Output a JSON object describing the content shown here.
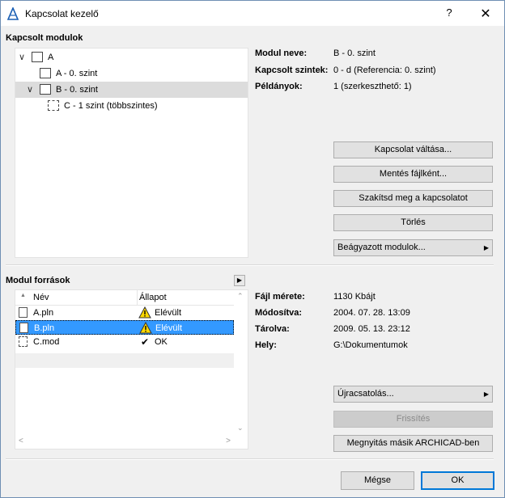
{
  "window": {
    "title": "Kapcsolat kezelő",
    "help_glyph": "?",
    "close_glyph": "✕"
  },
  "linked_modules": {
    "section_title": "Kapcsolt modulok",
    "tree": [
      {
        "label": "A",
        "expanded": true,
        "selected": false,
        "icon": "module-icon"
      },
      {
        "label": "A - 0. szint",
        "selected": false,
        "icon": "story-icon"
      },
      {
        "label": "B - 0. szint",
        "expanded": true,
        "selected": true,
        "icon": "story-icon"
      },
      {
        "label": "C - 1 szint (többszintes)",
        "selected": false,
        "icon": "multistory-icon"
      }
    ]
  },
  "module_info": {
    "name_label": "Modul neve:",
    "name_value": "B - 0. szint",
    "stories_label": "Kapcsolt szintek:",
    "stories_value": "0 - d (Referencia: 0. szint)",
    "instances_label": "Példányok:",
    "instances_value": "1 (szerkeszthető: 1)"
  },
  "module_buttons": {
    "switch": "Kapcsolat váltása...",
    "save_as_file": "Mentés fájlként...",
    "break_link": "Szakítsd meg a kapcsolatot",
    "delete": "Törlés",
    "nested": "Beágyazott modulok..."
  },
  "module_sources": {
    "section_title": "Modul források",
    "columns": [
      "Név",
      "Állapot"
    ],
    "rows": [
      {
        "name": "A.pln",
        "status": "Elévült",
        "status_icon": "warning-icon",
        "selected": false
      },
      {
        "name": "B.pln",
        "status": "Elévült",
        "status_icon": "warning-icon",
        "selected": true
      },
      {
        "name": "C.mod",
        "status": "OK",
        "status_icon": "check-icon",
        "selected": false
      }
    ]
  },
  "source_info": {
    "size_label": "Fájl mérete:",
    "size_value": "1130 Kbájt",
    "modified_label": "Módosítva:",
    "modified_value": "2004. 07. 28. 13:09",
    "stored_label": "Tárolva:",
    "stored_value": "2009. 05. 13. 23:12",
    "location_label": "Hely:",
    "location_value": "G:\\Dokumentumok"
  },
  "source_buttons": {
    "relink": "Újracsatolás...",
    "refresh": "Frissítés",
    "open_other": "Megnyitás másik ARCHICAD-ben"
  },
  "footer": {
    "cancel": "Mégse",
    "ok": "OK"
  }
}
